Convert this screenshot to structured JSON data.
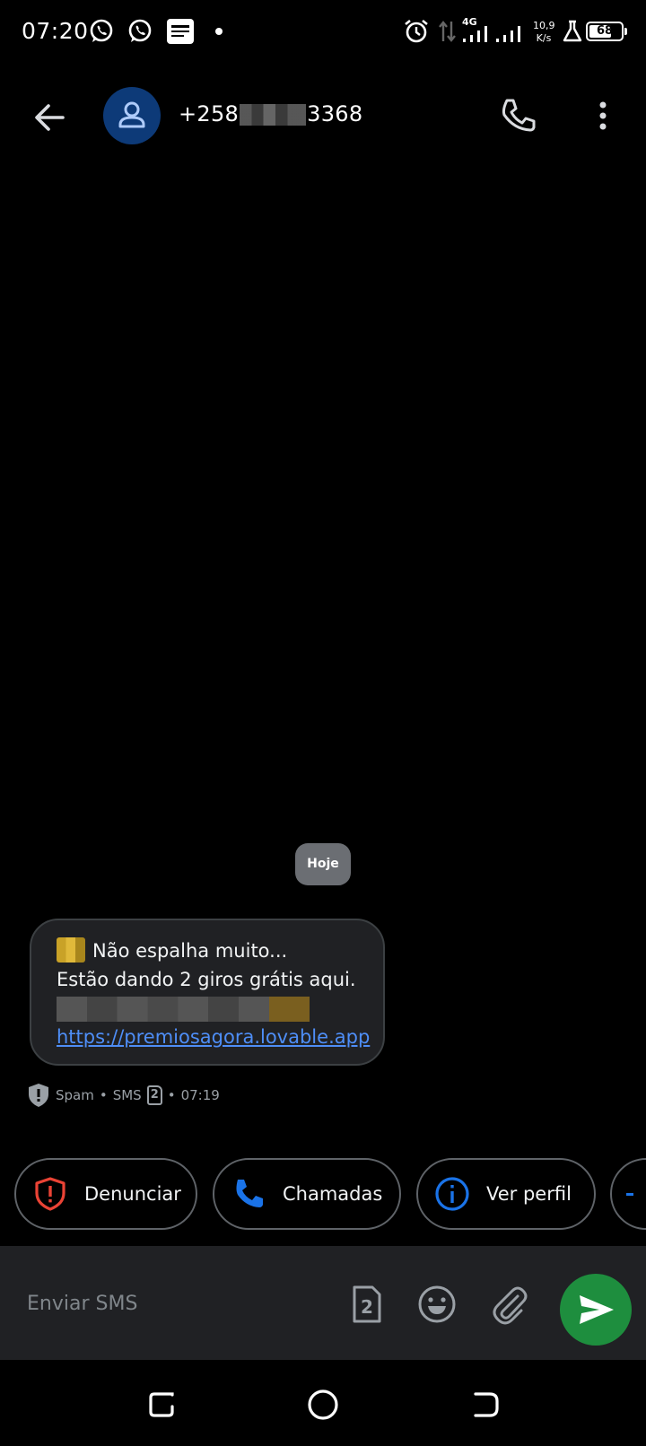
{
  "status_bar": {
    "time": "07:20",
    "network_type": "4G",
    "net_speed_value": "10,9",
    "net_speed_unit": "K/s",
    "battery_level": "68",
    "icons": [
      "whatsapp-icon",
      "whatsapp-icon",
      "news-icon",
      "dot-icon",
      "alarm-icon",
      "data-arrows-icon",
      "signal-icon",
      "signal-icon",
      "lab-icon",
      "battery-icon"
    ]
  },
  "top_bar": {
    "contact_prefix": "+258",
    "contact_suffix": "3368",
    "icons": [
      "back-arrow-icon",
      "person-icon",
      "phone-icon",
      "more-vert-icon"
    ]
  },
  "conversation": {
    "date_chip": "Hoje",
    "message": {
      "line1": "Não espalha muito...",
      "line2": "Estão dando 2 giros grátis aqui.",
      "link": "https://premiosagora.lovable.app"
    },
    "meta": {
      "label": "Spam",
      "type": "SMS",
      "sim": "2",
      "time": "07:19",
      "separator": "•"
    }
  },
  "chips": [
    {
      "label": "Denunciar",
      "icon": "report-shield-icon"
    },
    {
      "label": "Chamadas",
      "icon": "phone-icon"
    },
    {
      "label": "Ver perfil",
      "icon": "info-icon"
    }
  ],
  "compose": {
    "placeholder": "Enviar SMS",
    "sim": "2",
    "icons": [
      "sim-2-icon",
      "emoji-icon",
      "attach-icon",
      "send-icon"
    ]
  },
  "colors": {
    "background": "#000000",
    "bubble": "#202124",
    "link": "#4e8ef7",
    "send": "#1e8e3e",
    "report": "#ea4335",
    "accent_blue": "#1a73e8"
  }
}
